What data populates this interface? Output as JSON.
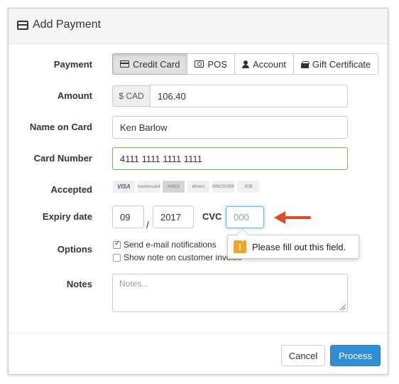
{
  "header": {
    "title": "Add Payment",
    "icon": "credit-card-icon"
  },
  "payment": {
    "label": "Payment",
    "methods": [
      {
        "label": "Credit Card",
        "icon": "credit-card-icon",
        "active": true
      },
      {
        "label": "POS",
        "icon": "pos-icon",
        "active": false
      },
      {
        "label": "Account",
        "icon": "user-icon",
        "active": false
      },
      {
        "label": "Gift Certificate",
        "icon": "gift-icon",
        "active": false
      }
    ]
  },
  "amount": {
    "label": "Amount",
    "currency": "$ CAD",
    "value": "106.40"
  },
  "name_on_card": {
    "label": "Name on Card",
    "value": "Ken Barlow"
  },
  "card_number": {
    "label": "Card Number",
    "value": "4111 1111 1111 1111"
  },
  "accepted": {
    "label": "Accepted",
    "cards": [
      "VISA",
      "mastercard",
      "AMEX",
      "diners",
      "DISCOVER",
      "JCB"
    ]
  },
  "expiry": {
    "label": "Expiry date",
    "month": "09",
    "separator": "/",
    "year": "2017"
  },
  "cvc": {
    "label": "CVC",
    "placeholder": "000"
  },
  "validation": {
    "message": "Please fill out this field.",
    "icon": "warning-icon",
    "icon_glyph": "!"
  },
  "options": {
    "label": "Options",
    "items": [
      {
        "label": "Send e-mail notifications",
        "checked": true
      },
      {
        "label": "Show note on customer invoice",
        "checked": false
      }
    ]
  },
  "notes": {
    "label": "Notes",
    "placeholder": "Notes..."
  },
  "footer": {
    "cancel_label": "Cancel",
    "process_label": "Process"
  },
  "colors": {
    "primary": "#2f8fd6",
    "success_border": "#7cb342",
    "warning": "#f0a526",
    "arrow": "#e8462a"
  }
}
